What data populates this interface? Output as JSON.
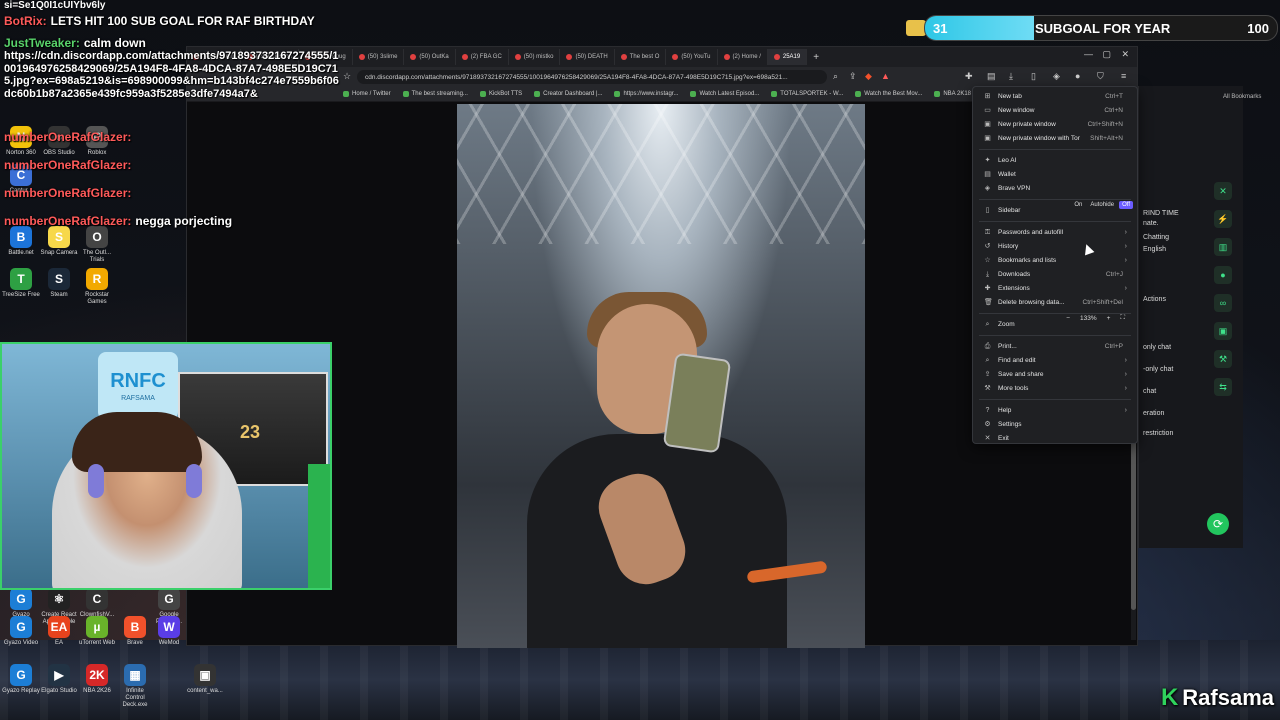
{
  "overlay": {
    "top_left_text": "si=Se1Q0I1cUIYbv6ly",
    "chat": [
      {
        "name": "BotRix:",
        "text": "LETS HIT 100 SUB GOAL FOR RAF BIRTHDAY",
        "green": false
      },
      {
        "name": "JustTweaker:",
        "text": "calm down",
        "green": true
      },
      {
        "name": "numberOneRafGlazer:",
        "text": "",
        "green": false
      },
      {
        "name": "numberOneRafGlazer:",
        "text": "",
        "green": false
      },
      {
        "name": "numberOneRafGlazer:",
        "text": "",
        "green": false
      },
      {
        "name": "numberOneRafGlazer:",
        "text": "negga porjecting",
        "green": false
      }
    ],
    "url_text": "https://cdn.discordapp.com/attachments/971893732167274555/1001964976258429069/25A194F8-4FA8-4DCA-87A7-498E5D19C715.jpg?ex=698a5219&is=698900099&hm=b143bf4c274e7559b6f06dc60b1b87a2365e439fc959a3f5285e3dfe7494a7&",
    "subgoal": {
      "count": "31",
      "label": "SUBGOAL FOR YEAR",
      "goal": "100",
      "progress": 0.31
    },
    "streamer_name": "Rafsama",
    "webcam_banner_title": "RNFC",
    "webcam_banner_sub": "RAFSAMA",
    "webcam_poster_number": "23"
  },
  "desktop_icons": [
    {
      "label": "Norton 360",
      "glyph": "N",
      "color": "#f2c20a"
    },
    {
      "label": "OBS Studio",
      "glyph": "●",
      "color": "#333333"
    },
    {
      "label": "Roblox",
      "glyph": "R",
      "color": "#555555"
    },
    {
      "label": "Captur...",
      "glyph": "C",
      "color": "#3b6fd6"
    },
    {
      "label": "Battle.net",
      "glyph": "B",
      "color": "#1c74d9"
    },
    {
      "label": "Snap Camera",
      "glyph": "S",
      "color": "#f7d84a"
    },
    {
      "label": "The Outl... Trials",
      "glyph": "O",
      "color": "#444444"
    },
    {
      "label": "TreeSize Free",
      "glyph": "T",
      "color": "#2ea043"
    },
    {
      "label": "Steam",
      "glyph": "S",
      "color": "#1b2838"
    },
    {
      "label": "Rockstar Games",
      "glyph": "R",
      "color": "#f2a900"
    },
    {
      "label": "Gyazo",
      "glyph": "G",
      "color": "#1c7ed6"
    },
    {
      "label": "Create React App Sample",
      "glyph": "⚛",
      "color": "#222222"
    },
    {
      "label": "ClownfishV...",
      "glyph": "C",
      "color": "#333333"
    },
    {
      "label": "Google Passwo...",
      "glyph": "G",
      "color": "#444444"
    },
    {
      "label": "Gyazo Video",
      "glyph": "G",
      "color": "#1c7ed6"
    },
    {
      "label": "EA",
      "glyph": "EA",
      "color": "#e8431d"
    },
    {
      "label": "uTorrent Web",
      "glyph": "µ",
      "color": "#69b32a"
    },
    {
      "label": "Brave",
      "glyph": "B",
      "color": "#f2512b"
    },
    {
      "label": "WeMod",
      "glyph": "W",
      "color": "#5a3de6"
    },
    {
      "label": "Gyazo Replay",
      "glyph": "G",
      "color": "#1c7ed6"
    },
    {
      "label": "Elgato Studio",
      "glyph": "▶",
      "color": "#223344"
    },
    {
      "label": "NBA 2K26",
      "glyph": "2K",
      "color": "#d62828"
    },
    {
      "label": "Infinite Control Deck.exe",
      "glyph": "▦",
      "color": "#2b6cb0"
    },
    {
      "label": "content_wa...",
      "glyph": "▣",
      "color": "#333333"
    }
  ],
  "browser": {
    "tabs": [
      {
        "label": "(49) epstein",
        "active": false
      },
      {
        "label": "(49) Question",
        "active": false
      },
      {
        "label": "(50) I Broug",
        "active": false
      },
      {
        "label": "(50) 3slime",
        "active": false
      },
      {
        "label": "(50) OutKa",
        "active": false
      },
      {
        "label": "(2) FBA GC",
        "active": false
      },
      {
        "label": "(50) mistko",
        "active": false
      },
      {
        "label": "(50) DEATH",
        "active": false
      },
      {
        "label": "The best O",
        "active": false
      },
      {
        "label": "(50) YouTu",
        "active": false
      },
      {
        "label": "(2) Home /",
        "active": false
      },
      {
        "label": "25A19",
        "active": true
      }
    ],
    "url": "cdn.discordapp.com/attachments/971893732167274555/1001964976258429069/25A194F8-4FA8-4DCA-87A7-498E5D19C715.jpg?ex=698a521...",
    "bookmarks": [
      "Home / Twitter",
      "The best streaming...",
      "KickBot TTS",
      "Creator Dashboard |...",
      "https://www.instagr...",
      "Watch Latest Episod...",
      "TOTALSPORTEK - W...",
      "Watch the Best Mov...",
      "NBA 2K18 ROM & I...",
      "P-Stream"
    ],
    "bookmarks_right": "All Bookmarks"
  },
  "menu": {
    "groups": [
      [
        {
          "label": "New tab",
          "shortcut": "Ctrl+T",
          "icon": "⊞"
        },
        {
          "label": "New window",
          "shortcut": "Ctrl+N",
          "icon": "▭"
        },
        {
          "label": "New private window",
          "shortcut": "Ctrl+Shift+N",
          "icon": "▣"
        },
        {
          "label": "New private window with Tor",
          "shortcut": "Shift+Alt+N",
          "icon": "▣"
        }
      ],
      [
        {
          "label": "Leo AI",
          "shortcut": "",
          "icon": "✦"
        },
        {
          "label": "Wallet",
          "shortcut": "",
          "icon": "▤"
        },
        {
          "label": "Brave VPN",
          "shortcut": "",
          "icon": "◈"
        }
      ],
      [
        {
          "label": "Sidebar",
          "shortcut": "",
          "icon": "▯"
        }
      ],
      [
        {
          "label": "Passwords and autofill",
          "shortcut": "",
          "icon": "⚿",
          "arrow": true
        },
        {
          "label": "History",
          "shortcut": "",
          "icon": "↺",
          "arrow": true
        },
        {
          "label": "Bookmarks and lists",
          "shortcut": "",
          "icon": "☆",
          "arrow": true
        },
        {
          "label": "Downloads",
          "shortcut": "Ctrl+J",
          "icon": "⤓"
        },
        {
          "label": "Extensions",
          "shortcut": "",
          "icon": "✚",
          "arrow": true
        },
        {
          "label": "Delete browsing data...",
          "shortcut": "Ctrl+Shift+Del",
          "icon": "🗑"
        }
      ],
      [
        {
          "label": "Zoom",
          "shortcut": "",
          "icon": "⌕"
        }
      ],
      [
        {
          "label": "Print...",
          "shortcut": "Ctrl+P",
          "icon": "⎙"
        },
        {
          "label": "Find and edit",
          "shortcut": "",
          "icon": "⌕",
          "arrow": true
        },
        {
          "label": "Save and share",
          "shortcut": "",
          "icon": "⇪",
          "arrow": true
        },
        {
          "label": "More tools",
          "shortcut": "",
          "icon": "⚒",
          "arrow": true
        }
      ],
      [
        {
          "label": "Help",
          "shortcut": "",
          "icon": "?",
          "arrow": true
        },
        {
          "label": "Settings",
          "shortcut": "",
          "icon": "⚙"
        },
        {
          "label": "Exit",
          "shortcut": "",
          "icon": "✕"
        }
      ]
    ],
    "sidebar_options": [
      "On",
      "Autohide",
      "Off"
    ],
    "zoom": {
      "minus": "−",
      "value": "133%",
      "plus": "+",
      "fullscreen": "⛶"
    }
  },
  "side_panel": {
    "rows": [
      "RIND TIME",
      "nate.",
      "Chatting",
      "English",
      "Actions",
      "only chat",
      "-only chat",
      "chat",
      "eration",
      "restriction"
    ]
  }
}
